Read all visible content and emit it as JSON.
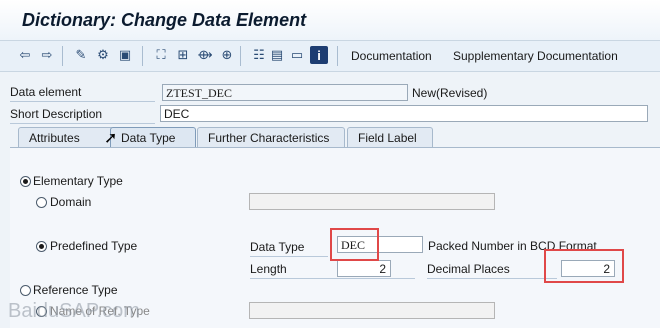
{
  "window": {
    "title": "Dictionary: Change Data Element"
  },
  "toolbar": {
    "icons": [
      "arrow-left-icon",
      "arrow-right-icon",
      "display-change-icon",
      "check-icon",
      "stack-icon",
      "activate-icon",
      "tree-icon",
      "cascade-icon",
      "where-used-icon",
      "list-icon",
      "info-icon"
    ],
    "documentation_label": "Documentation",
    "supplementary_label": "Supplementary Documentation"
  },
  "header": {
    "data_element_label": "Data element",
    "data_element_value": "ZTEST_DEC",
    "status": "New(Revised)",
    "short_desc_label": "Short Description",
    "short_desc_value": "DEC"
  },
  "tabs": [
    {
      "label": "Attributes"
    },
    {
      "label": "Data Type"
    },
    {
      "label": "Further Characteristics"
    },
    {
      "label": "Field Label"
    }
  ],
  "panel": {
    "elementary_type_label": "Elementary Type",
    "domain_label": "Domain",
    "predefined_type_label": "Predefined Type",
    "data_type_label": "Data Type",
    "data_type_value": "DEC",
    "data_type_desc": "Packed Number in BCD Format",
    "length_label": "Length",
    "length_value": "2",
    "decimal_places_label": "Decimal Places",
    "decimal_places_value": "2",
    "reference_type_label": "Reference Type",
    "name_ref_type_label": "Name of Ref. Type"
  },
  "watermark": "BaiduSAP.com",
  "colors": {
    "highlight": "#e04848",
    "accent": "#2a4b74"
  }
}
